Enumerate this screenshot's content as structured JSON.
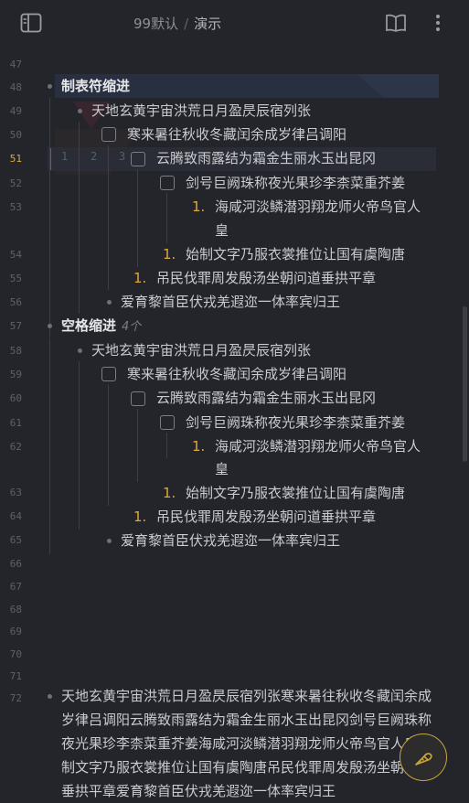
{
  "topbar": {
    "breadcrumb_root": "99默认",
    "breadcrumb_separator": "/",
    "breadcrumb_current": "演示",
    "icons": [
      "sidebar-toggle-icon",
      "book-icon",
      "more-vertical-icon"
    ]
  },
  "editor": {
    "active_line": "51",
    "tab_markers": [
      "1",
      "2",
      "3"
    ],
    "line_numbers": [
      "47",
      "48",
      "49",
      "50",
      "51",
      "52",
      "53",
      "54",
      "55",
      "56",
      "57",
      "58",
      "59",
      "60",
      "61",
      "62",
      "63",
      "64",
      "65",
      "66",
      "67",
      "68",
      "69",
      "70",
      "71",
      "72"
    ],
    "section1": {
      "heading": "制表符缩进",
      "items": [
        {
          "marker": "bullet",
          "text": "天地玄黄宇宙洪荒日月盈昃辰宿列张"
        },
        {
          "marker": "checkbox",
          "text": "寒来暑往秋收冬藏闰余成岁律吕调阳"
        },
        {
          "marker": "checkbox",
          "text": "云腾致雨露结为霜金生丽水玉出昆冈"
        },
        {
          "marker": "checkbox",
          "text": "剑号巨阙珠称夜光果珍李柰菜重芥姜"
        },
        {
          "marker": "number",
          "num": "1.",
          "text": "海咸河淡鳞潜羽翔龙师火帝鸟官人",
          "text2": "皇"
        },
        {
          "marker": "number",
          "num": "1.",
          "text": "始制文字乃服衣裳推位让国有虞陶唐"
        },
        {
          "marker": "number",
          "num": "1.",
          "text": "吊民伐罪周发殷汤坐朝问道垂拱平章"
        },
        {
          "marker": "bullet",
          "text": "爱育黎首臣伏戎羌遐迩一体率宾归王"
        }
      ]
    },
    "section2": {
      "heading": "空格缩进",
      "count": "4个",
      "items": [
        {
          "marker": "bullet",
          "text": "天地玄黄宇宙洪荒日月盈昃辰宿列张"
        },
        {
          "marker": "checkbox",
          "text": "寒来暑往秋收冬藏闰余成岁律吕调阳"
        },
        {
          "marker": "checkbox",
          "text": "云腾致雨露结为霜金生丽水玉出昆冈"
        },
        {
          "marker": "checkbox",
          "text": "剑号巨阙珠称夜光果珍李柰菜重芥姜"
        },
        {
          "marker": "number",
          "num": "1.",
          "text": "海咸河淡鳞潜羽翔龙师火帝鸟官人",
          "text2": "皇"
        },
        {
          "marker": "number",
          "num": "1.",
          "text": "始制文字乃服衣裳推位让国有虞陶唐"
        },
        {
          "marker": "number",
          "num": "1.",
          "text": "吊民伐罪周发殷汤坐朝问道垂拱平章"
        },
        {
          "marker": "bullet",
          "text": "爱育黎首臣伏戎羌遐迩一体率宾归王"
        }
      ]
    },
    "paragraph": "天地玄黄宇宙洪荒日月盈昃辰宿列张寒来暑往秋收冬藏闰余成岁律吕调阳云腾致雨露结为霜金生丽水玉出昆冈剑号巨阙珠称夜光果珍李柰菜重芥姜海咸河淡鳞潜羽翔龙师火帝鸟官人皇始制文字乃服衣裳推位让国有虞陶唐吊民伐罪周发殷汤坐朝问道垂拱平章爱育黎首臣伏戎羌遐迩一体率宾归王"
  },
  "fab": {
    "icon": "carrot-edit-icon"
  },
  "colors": {
    "background": "#23252b",
    "accent": "#e0a93c",
    "text": "#c9cbd0"
  }
}
